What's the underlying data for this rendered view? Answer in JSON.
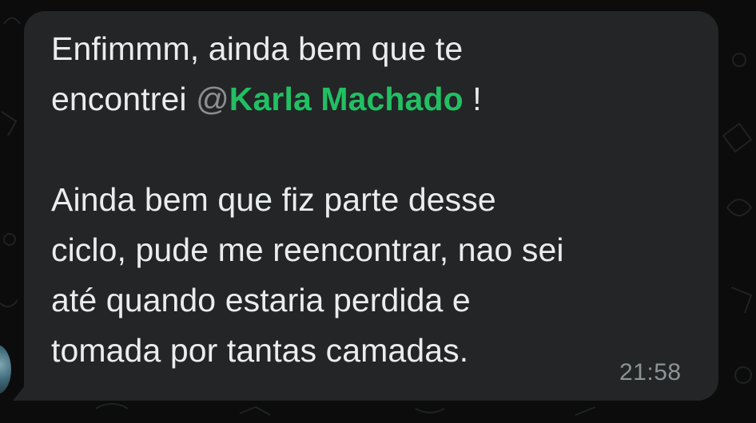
{
  "message": {
    "line1": "Enfimmm, ainda bem que te",
    "line2_prefix": "encontrei ",
    "mention_at": "@",
    "mention_name": "Karla Machado",
    "line2_suffix": " !",
    "paragraph2": [
      "Ainda bem que fiz parte desse",
      "ciclo, pude me reencontrar, nao sei",
      "até quando estaria perdida e",
      "tomada por tantas camadas."
    ],
    "time": "21:58"
  },
  "colors": {
    "bubble": "#232526",
    "background": "#0c0c0c",
    "text": "#e9edef",
    "mention": "#21c063",
    "timestamp": "#8c9397"
  },
  "icons": {
    "avatar": "sender-avatar",
    "background": "chat-doodle-pattern"
  }
}
